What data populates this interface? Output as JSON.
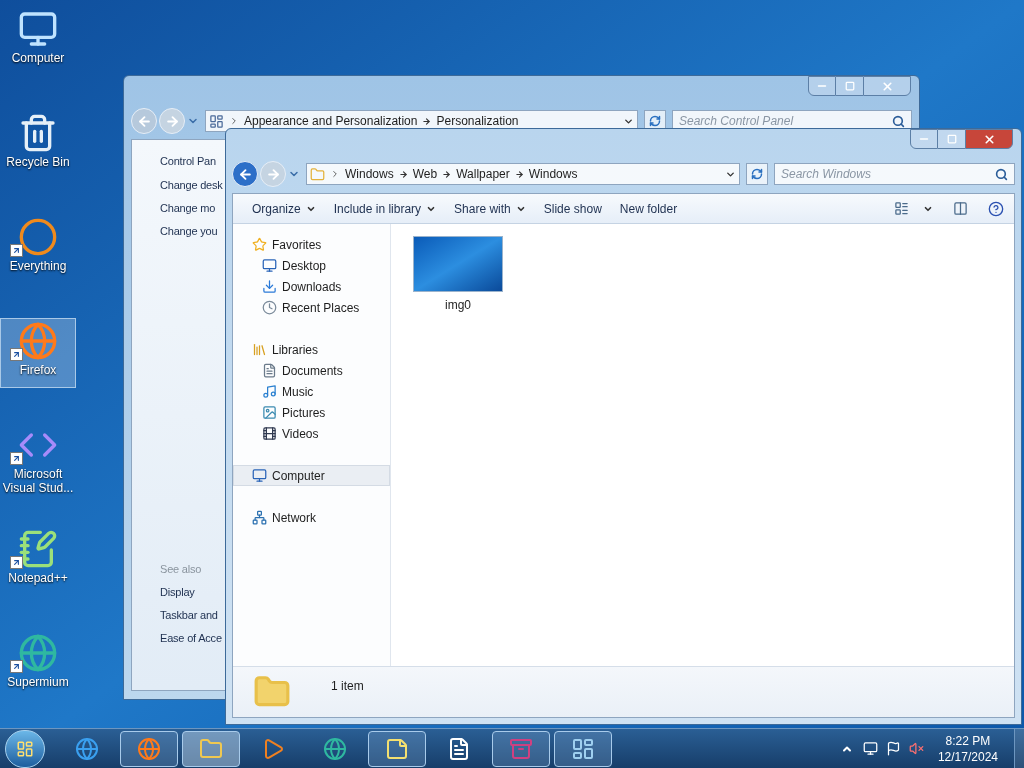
{
  "desktop_icons": [
    {
      "label": "Computer",
      "kind": "computer",
      "shortcut": false,
      "selected": false
    },
    {
      "label": "Recycle Bin",
      "kind": "recycle",
      "shortcut": false,
      "selected": false
    },
    {
      "label": "Everything",
      "kind": "ring",
      "shortcut": true,
      "selected": false
    },
    {
      "label": "Firefox",
      "kind": "browser",
      "shortcut": true,
      "selected": true
    },
    {
      "label": "Microsoft Visual Stud...",
      "kind": "ide",
      "shortcut": true,
      "selected": false
    },
    {
      "label": "Notepad++",
      "kind": "notepad",
      "shortcut": true,
      "selected": false
    },
    {
      "label": "Supermium",
      "kind": "globe",
      "shortcut": true,
      "selected": false
    }
  ],
  "control_panel_window": {
    "breadcrumb": [
      "Appearance and Personalization",
      "Personalization"
    ],
    "search": {
      "placeholder": "Search Control Panel"
    },
    "links": [
      "Control Pan",
      "Change desk",
      "Change mo",
      "Change you"
    ],
    "see_also": {
      "heading": "See also",
      "links": [
        "Display",
        "Taskbar and",
        "Ease of Acce"
      ]
    }
  },
  "explorer_window": {
    "breadcrumb": [
      "Windows",
      "Web",
      "Wallpaper",
      "Windows"
    ],
    "search": {
      "placeholder": "Search Windows"
    },
    "toolbar": [
      {
        "label": "Organize",
        "dropdown": true
      },
      {
        "label": "Include in library",
        "dropdown": true
      },
      {
        "label": "Share with",
        "dropdown": true
      },
      {
        "label": "Slide show",
        "dropdown": false
      },
      {
        "label": "New folder",
        "dropdown": false
      }
    ],
    "sidebar": [
      {
        "label": "Favorites",
        "kind": "star",
        "selected": false,
        "children": [
          {
            "label": "Desktop",
            "kind": "desktop",
            "selected": false
          },
          {
            "label": "Downloads",
            "kind": "download",
            "selected": false
          },
          {
            "label": "Recent Places",
            "kind": "recent",
            "selected": false
          }
        ]
      },
      {
        "label": "Libraries",
        "kind": "library",
        "selected": false,
        "children": [
          {
            "label": "Documents",
            "kind": "document",
            "selected": false
          },
          {
            "label": "Music",
            "kind": "music",
            "selected": false
          },
          {
            "label": "Pictures",
            "kind": "picture",
            "selected": false
          },
          {
            "label": "Videos",
            "kind": "video",
            "selected": false
          }
        ]
      },
      {
        "label": "Computer",
        "kind": "computer",
        "selected": true
      },
      {
        "label": "Network",
        "kind": "network",
        "selected": false
      }
    ],
    "files": [
      {
        "name": "img0",
        "selected": false
      }
    ],
    "status": "1 item"
  },
  "taskbar": {
    "apps": [
      {
        "kind": "ie",
        "running": false,
        "active": false
      },
      {
        "kind": "browser",
        "running": true,
        "active": false
      },
      {
        "kind": "folder",
        "running": true,
        "active": true
      },
      {
        "kind": "media",
        "running": false,
        "active": false
      },
      {
        "kind": "globe",
        "running": false,
        "active": false
      },
      {
        "kind": "notes",
        "running": true,
        "active": false
      },
      {
        "kind": "document",
        "running": false,
        "active": false
      },
      {
        "kind": "archive",
        "running": true,
        "active": false
      },
      {
        "kind": "panel",
        "running": true,
        "active": false
      }
    ],
    "clock": {
      "time": "8:22 PM",
      "date": "12/17/2024"
    }
  }
}
